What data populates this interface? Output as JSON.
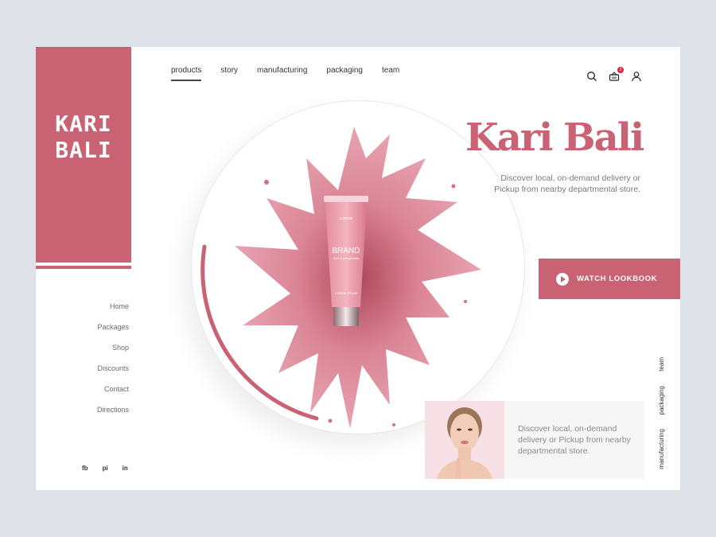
{
  "brand": {
    "name": "KARI\nBALI",
    "accent": "#c96272"
  },
  "top_nav": {
    "items": [
      {
        "label": "products",
        "active": true
      },
      {
        "label": "story",
        "active": false
      },
      {
        "label": "manufacturing",
        "active": false
      },
      {
        "label": "packaging",
        "active": false
      },
      {
        "label": "team",
        "active": false
      }
    ]
  },
  "header_icons": {
    "search": "search-icon",
    "cart": "basket-icon",
    "cart_count": "2",
    "account": "user-icon"
  },
  "side_nav": {
    "items": [
      "Home",
      "Packages",
      "Shop",
      "Discounts",
      "Contact",
      "Directions"
    ]
  },
  "social": {
    "items": [
      "fb",
      "pi",
      "in"
    ]
  },
  "hero": {
    "title": "Kari Bali",
    "description": "Discover local, on-demand delivery or Pickup from nearby departmental store.",
    "cta_label": "WATCH LOOKBOOK",
    "product": {
      "top_label": "LOREM",
      "brand": "BRAND",
      "tagline": "Sed ut perspiciatis",
      "bottom_label": "LOREM IPSUM"
    }
  },
  "vertical_nav": {
    "items": [
      "team",
      "packaging",
      "manufacturing"
    ]
  },
  "promo": {
    "text": "Discover local, on-demand delivery or Pickup from nearby departmental store."
  }
}
